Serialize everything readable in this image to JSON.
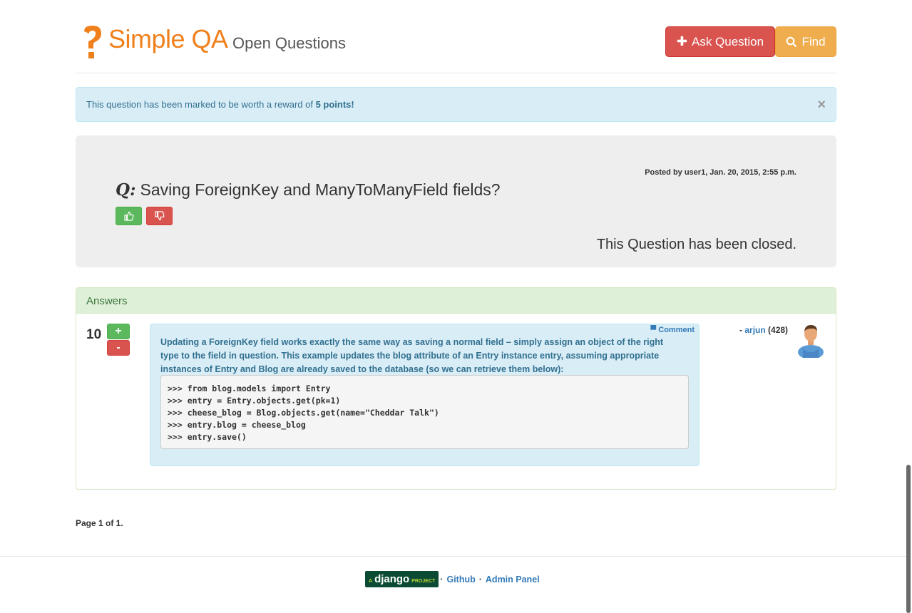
{
  "header": {
    "brand": "Simple QA",
    "subtitle": "Open Questions",
    "ask_label": "Ask Question",
    "find_label": "Find"
  },
  "alert": {
    "text_prefix": "This question has been marked to be worth a reward of ",
    "reward": "5 points!",
    "close": "×"
  },
  "question": {
    "posted": "Posted by user1, Jan. 20, 2015, 2:55 p.m.",
    "q_prefix": "Q:",
    "title": "Saving ForeignKey and ManyToManyField fields?",
    "status": "This Question has been closed."
  },
  "answers": {
    "heading": "Answers",
    "items": [
      {
        "score": "10",
        "up": "+",
        "down": "-",
        "comment_label": "Comment",
        "text": "Updating a ForeignKey field works exactly the same way as saving a normal field – simply assign an object of the right type to the field in question. This example updates the blog attribute of an Entry instance entry, assuming appropriate instances of Entry and Blog are already saved to the database (so we can retrieve them below):",
        "code": ">>> from blog.models import Entry\n>>> entry = Entry.objects.get(pk=1)\n>>> cheese_blog = Blog.objects.get(name=\"Cheddar Talk\")\n>>> entry.blog = cheese_blog\n>>> entry.save()",
        "author_prefix": "- ",
        "author": "arjun",
        "reputation": "(428)"
      }
    ]
  },
  "pagination": {
    "text": "Page 1 of 1."
  },
  "footer": {
    "django_small": "A",
    "django_big": "django",
    "django_project": "PROJECT",
    "github": "Github",
    "admin": "Admin Panel",
    "separator": "·"
  },
  "colors": {
    "brand": "#f0801c",
    "danger": "#d9534f",
    "warning": "#f0ad4e",
    "success": "#5cb85c",
    "info_bg": "#d9edf7",
    "link": "#337ab7"
  }
}
